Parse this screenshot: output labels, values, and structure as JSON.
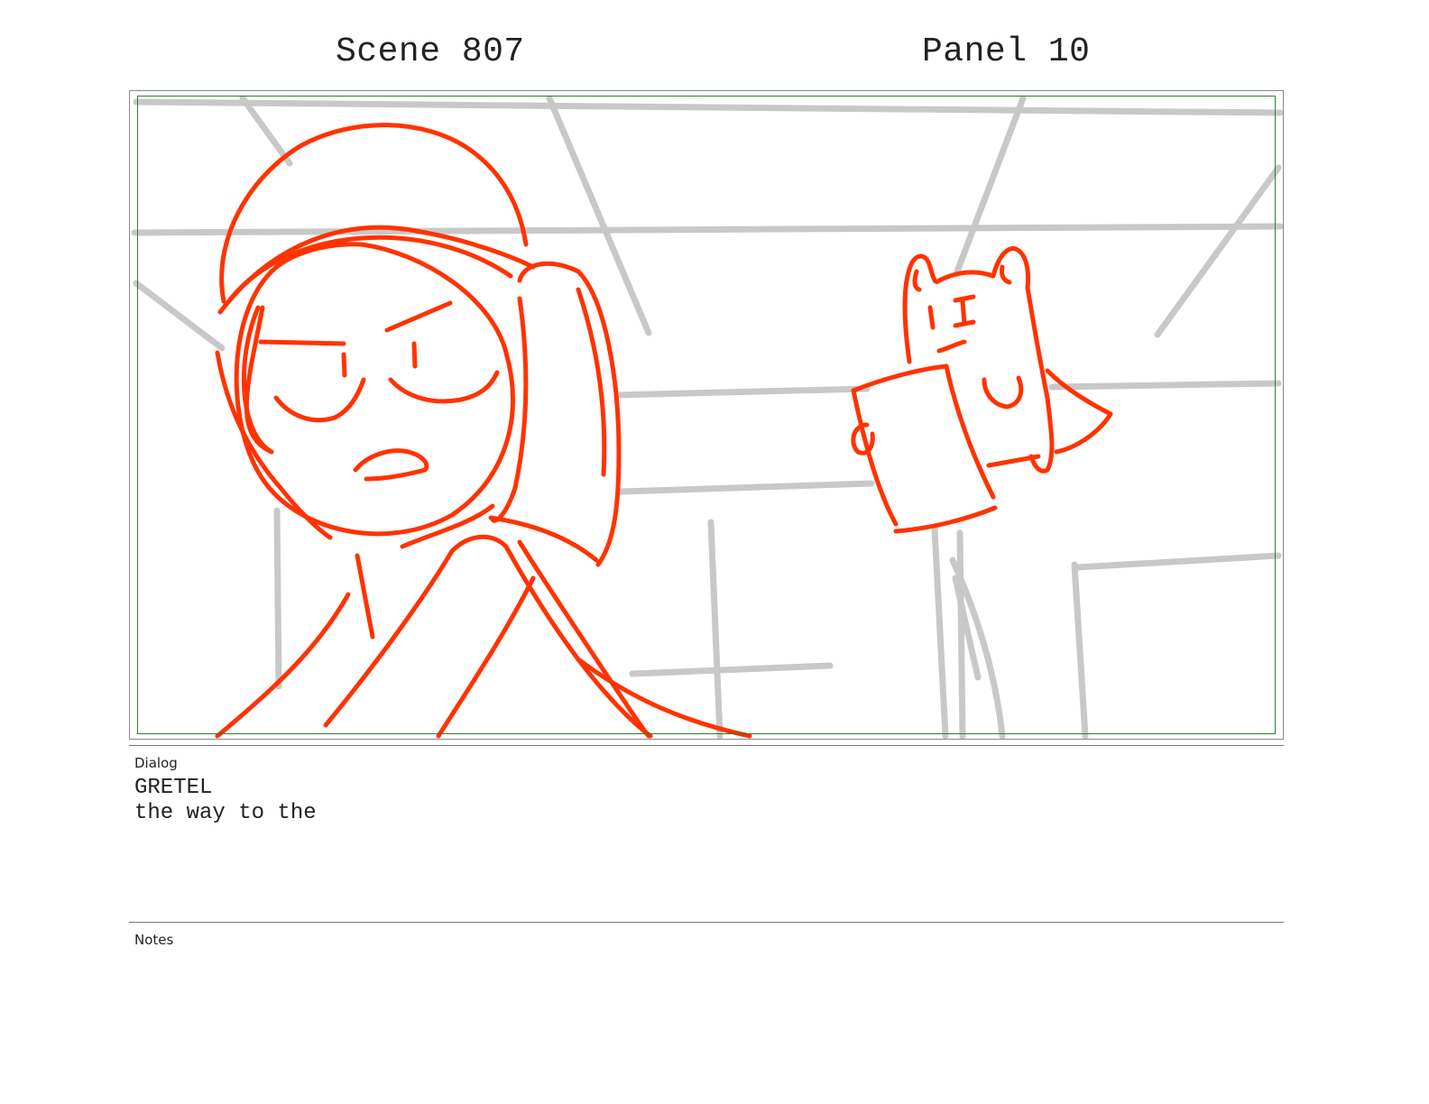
{
  "header": {
    "scene": "Scene 807",
    "panel": "Panel 10"
  },
  "artwork": {
    "sketch_color": "#ff3300",
    "background_line_color": "#c8c8c8",
    "safe_frame_color": "#2e7d32"
  },
  "dialog": {
    "label": "Dialog",
    "character": "GRETEL",
    "line": "the way to the"
  },
  "notes": {
    "label": "Notes"
  }
}
